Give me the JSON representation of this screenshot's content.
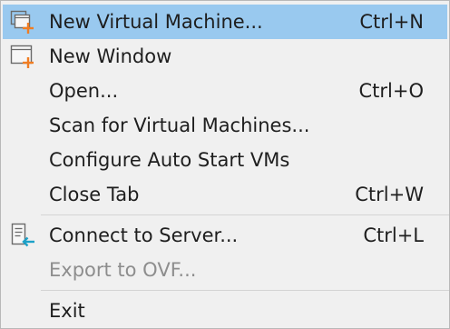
{
  "menu": {
    "items": [
      {
        "label": "New Virtual Machine...",
        "shortcut": "Ctrl+N",
        "icon": "new-vm-icon"
      },
      {
        "label": "New Window",
        "shortcut": "",
        "icon": "new-window-icon"
      },
      {
        "label": "Open...",
        "shortcut": "Ctrl+O"
      },
      {
        "label": "Scan for Virtual Machines...",
        "shortcut": ""
      },
      {
        "label": "Configure Auto Start VMs",
        "shortcut": ""
      },
      {
        "label": "Close Tab",
        "shortcut": "Ctrl+W"
      },
      {
        "label": "Connect to Server...",
        "shortcut": "Ctrl+L",
        "icon": "connect-server-icon"
      },
      {
        "label": "Export to OVF...",
        "shortcut": "",
        "disabled": true
      },
      {
        "label": "Exit",
        "shortcut": ""
      }
    ]
  },
  "colors": {
    "highlight": "#99c9ef",
    "menu_bg": "#f0f0f0",
    "accent_orange": "#f07d23",
    "accent_cyan": "#1da1c8",
    "disabled_text": "#8d8d8d"
  }
}
